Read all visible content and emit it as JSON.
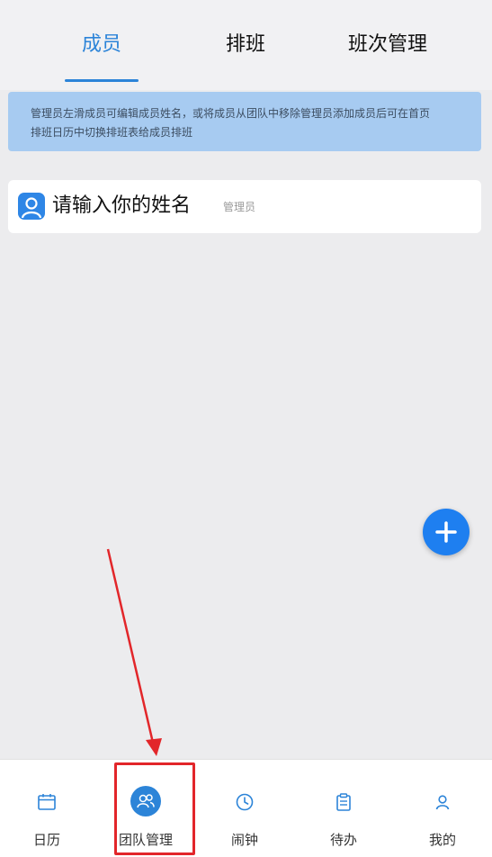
{
  "tabs": [
    {
      "label": "成员",
      "active": true
    },
    {
      "label": "排班",
      "active": false
    },
    {
      "label": "班次管理",
      "active": false
    }
  ],
  "notice": {
    "line1": "管理员左滑成员可编辑成员姓名，或将成员从团队中移除管理员添加成员后可在首页",
    "line2": "排班日历中切换排班表给成员排班"
  },
  "member": {
    "name": "请输入你的姓名",
    "role": "管理员",
    "icon": "user-avatar-icon"
  },
  "fab": {
    "icon": "plus-icon"
  },
  "bottom_nav": [
    {
      "label": "日历",
      "icon": "calendar-icon",
      "active": false
    },
    {
      "label": "团队管理",
      "icon": "team-icon",
      "active": true
    },
    {
      "label": "闹钟",
      "icon": "clock-icon",
      "active": false
    },
    {
      "label": "待办",
      "icon": "clipboard-icon",
      "active": false
    },
    {
      "label": "我的",
      "icon": "person-icon",
      "active": false
    }
  ],
  "colors": {
    "accent": "#2c84d8",
    "fab": "#1e7ff0",
    "notice_bg": "#a7cbf1",
    "annotation": "#e2262a"
  }
}
